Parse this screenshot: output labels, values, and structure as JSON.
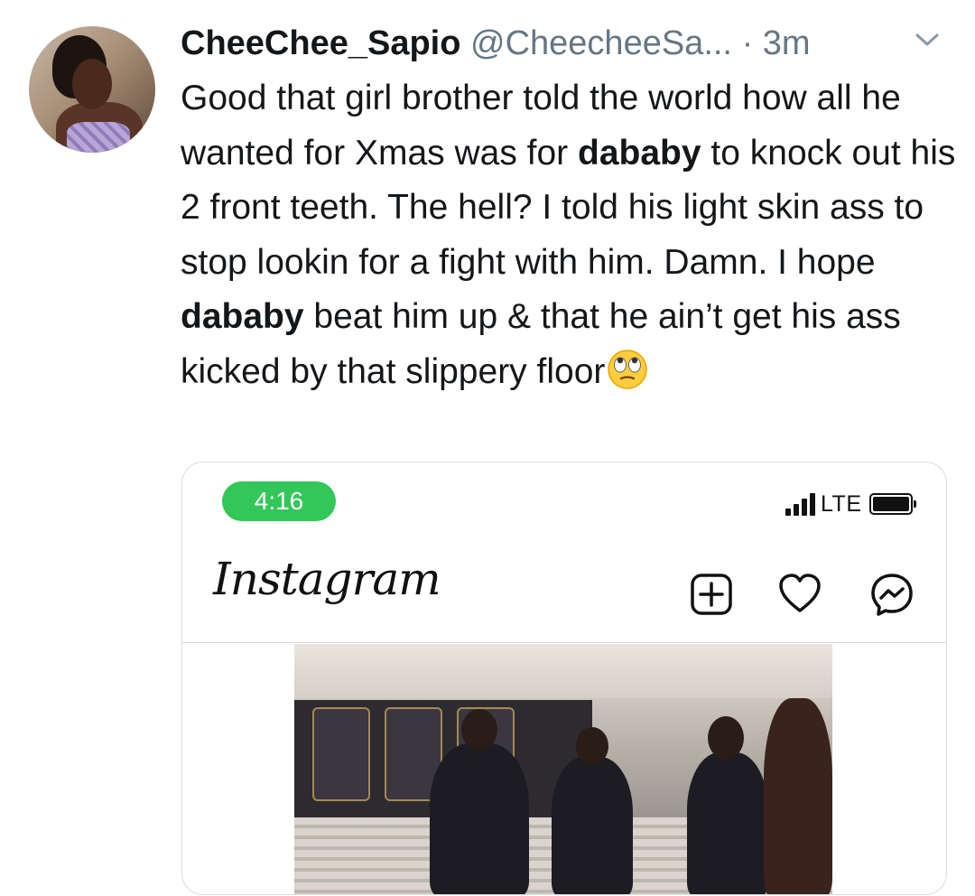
{
  "tweet": {
    "display_name": "CheeChee_Sapio",
    "handle": "@CheecheeSa...",
    "separator": "·",
    "time": "3m",
    "text": {
      "p1": "Good that girl brother told the world how all he wanted for Xmas was for ",
      "b1": "dababy",
      "p2": " to knock out his 2 front teeth. The hell? I told his light skin ass to stop lookin for a fight with him. Damn. I hope ",
      "b2": "dababy",
      "p3": " beat him up & that he ain’t get his ass kicked by that slippery floor"
    },
    "emoji": "face-with-rolling-eyes"
  },
  "icons": {
    "more": "chevron-down-icon",
    "new_post": "plus-square-icon",
    "activity": "heart-icon",
    "messages": "messenger-icon",
    "signal": "signal-bars-icon",
    "battery": "battery-icon"
  },
  "media": {
    "status_time": "4:16",
    "network": "LTE",
    "app_logo": "Instagram"
  },
  "colors": {
    "time_pill": "#33c759",
    "secondary_text": "#657786",
    "primary_text": "#14171a"
  }
}
